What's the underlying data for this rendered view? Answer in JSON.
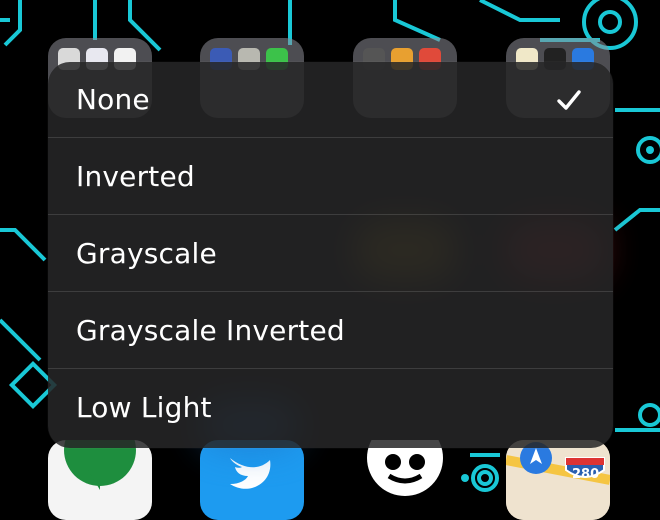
{
  "menu": {
    "items": [
      {
        "label": "None",
        "selected": true
      },
      {
        "label": "Inverted",
        "selected": false
      },
      {
        "label": "Grayscale",
        "selected": false
      },
      {
        "label": "Grayscale Inverted",
        "selected": false
      },
      {
        "label": "Low Light",
        "selected": false
      }
    ]
  },
  "dock": {
    "maps_route_shield": "280"
  },
  "colors": {
    "wallpaper_bg": "#000000",
    "circuit_line": "#19c8d6",
    "menu_bg": "#262628",
    "menu_text": "#ffffff",
    "separator": "#3a3a3c"
  },
  "icons": {
    "selected_marker": "checkmark-icon"
  }
}
